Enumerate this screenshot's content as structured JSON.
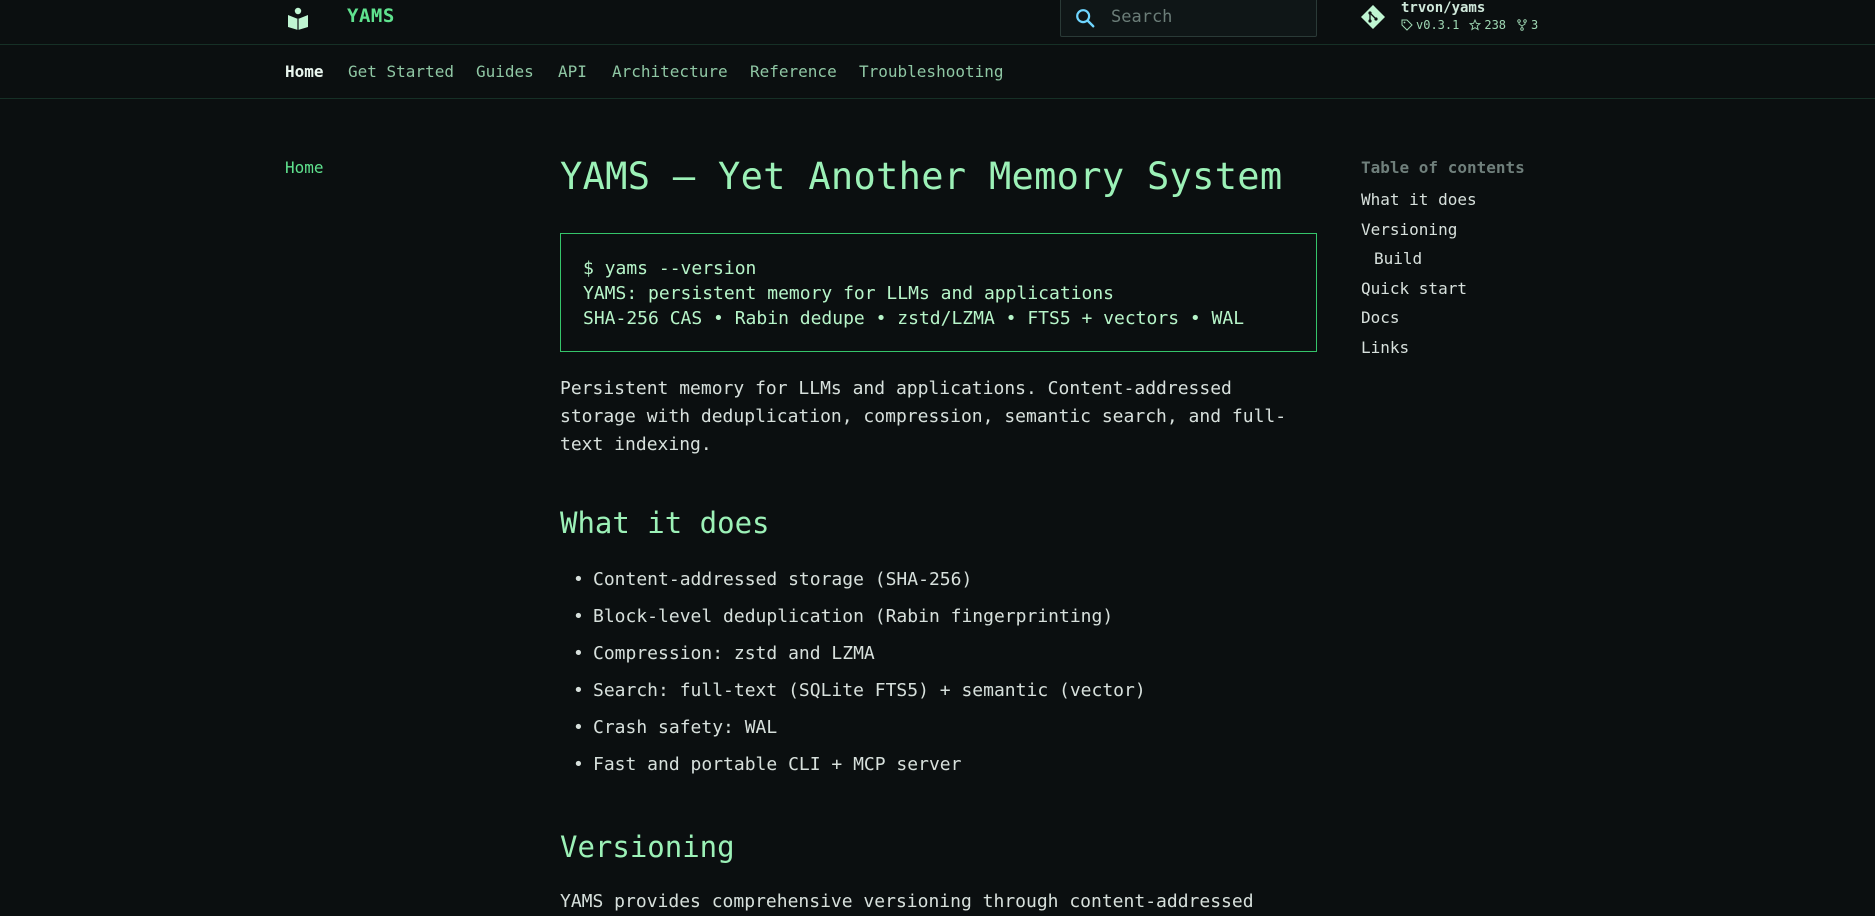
{
  "header": {
    "site_title": "YAMS",
    "search_placeholder": "Search",
    "repo": {
      "name": "trvon/yams",
      "version": "v0.3.1",
      "stars": "238",
      "forks": "3"
    }
  },
  "tabs": [
    {
      "label": "Home",
      "active": true
    },
    {
      "label": "Get Started"
    },
    {
      "label": "Guides"
    },
    {
      "label": "API"
    },
    {
      "label": "Architecture"
    },
    {
      "label": "Reference"
    },
    {
      "label": "Troubleshooting"
    }
  ],
  "sidebar": {
    "home_label": "Home"
  },
  "content": {
    "title": "YAMS — Yet Another Memory System",
    "code_lines": [
      "$ yams --version",
      "YAMS: persistent memory for LLMs and applications",
      "SHA-256 CAS • Rabin dedupe • zstd/LZMA • FTS5 + vectors • WAL"
    ],
    "intro": "Persistent memory for LLMs and applications. Content-addressed storage with deduplication, compression, semantic search, and full-text indexing.",
    "what_heading": "What it does",
    "what_items": [
      "Content-addressed storage (SHA-256)",
      "Block-level deduplication (Rabin fingerprinting)",
      "Compression: zstd and LZMA",
      "Search: full-text (SQLite FTS5) + semantic (vector)",
      "Crash safety: WAL",
      "Fast and portable CLI + MCP server"
    ],
    "versioning_heading": "Versioning",
    "versioning_text": "YAMS provides comprehensive versioning through content-addressed"
  },
  "toc": {
    "title": "Table of contents",
    "items": [
      {
        "label": "What it does"
      },
      {
        "label": "Versioning"
      },
      {
        "label": "Build",
        "sub": true
      },
      {
        "label": "Quick start"
      },
      {
        "label": "Docs"
      },
      {
        "label": "Links"
      }
    ]
  },
  "colors": {
    "background": "#0b0f10",
    "accent": "#5fe28e",
    "heading": "#9cf1b7",
    "code_border": "#35c46a"
  }
}
